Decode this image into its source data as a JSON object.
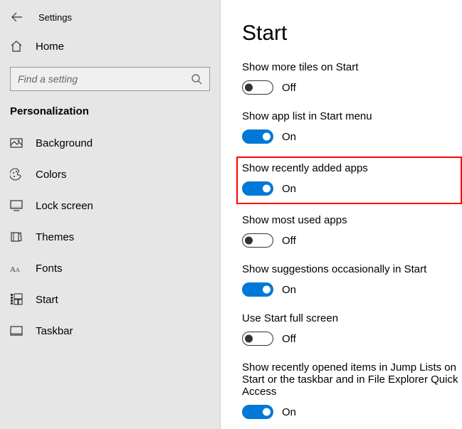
{
  "header": {
    "app_title": "Settings"
  },
  "sidebar": {
    "home_label": "Home",
    "search_placeholder": "Find a setting",
    "section_label": "Personalization",
    "items": [
      {
        "label": "Background"
      },
      {
        "label": "Colors"
      },
      {
        "label": "Lock screen"
      },
      {
        "label": "Themes"
      },
      {
        "label": "Fonts"
      },
      {
        "label": "Start"
      },
      {
        "label": "Taskbar"
      }
    ]
  },
  "main": {
    "title": "Start",
    "on_text": "On",
    "off_text": "Off",
    "settings": [
      {
        "label": "Show more tiles on Start",
        "on": false,
        "highlighted": false
      },
      {
        "label": "Show app list in Start menu",
        "on": true,
        "highlighted": false
      },
      {
        "label": "Show recently added apps",
        "on": true,
        "highlighted": true
      },
      {
        "label": "Show most used apps",
        "on": false,
        "highlighted": false
      },
      {
        "label": "Show suggestions occasionally in Start",
        "on": true,
        "highlighted": false
      },
      {
        "label": "Use Start full screen",
        "on": false,
        "highlighted": false
      },
      {
        "label": "Show recently opened items in Jump Lists on Start or the taskbar and in File Explorer Quick Access",
        "on": true,
        "highlighted": false
      }
    ]
  }
}
